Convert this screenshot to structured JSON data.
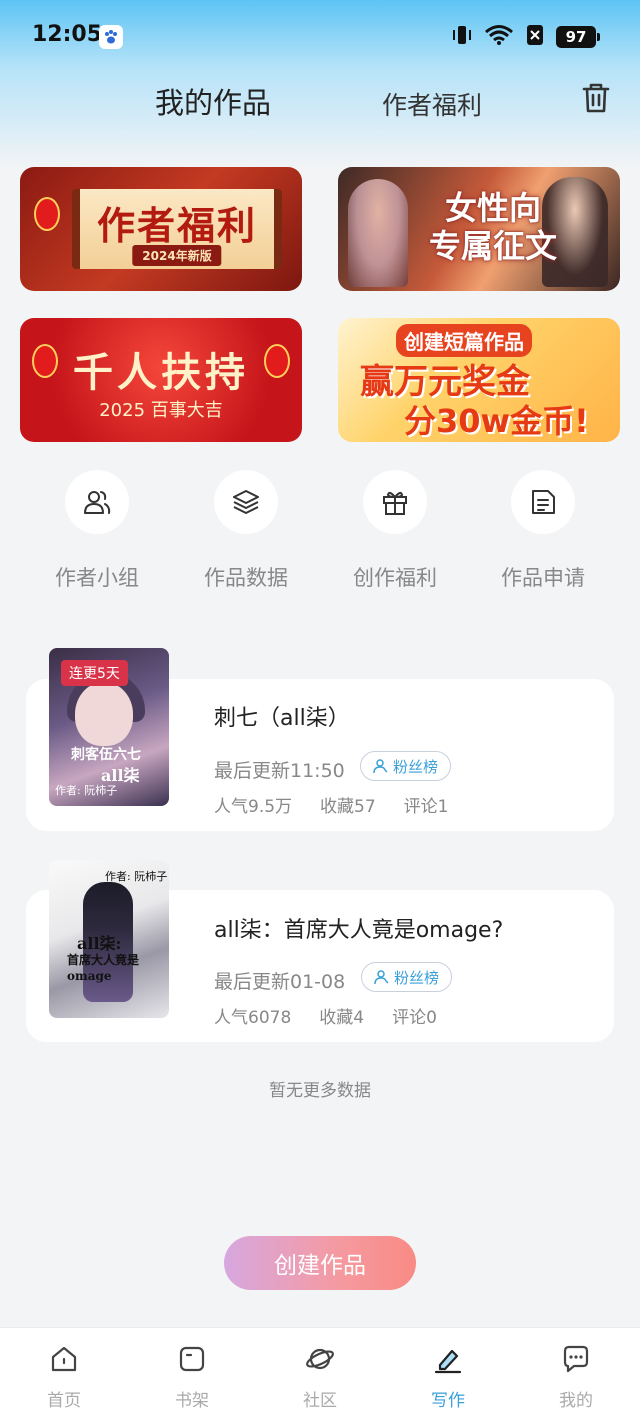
{
  "status_bar": {
    "time": "12:05",
    "battery": "97",
    "icons": [
      "baidu-app-icon",
      "vibrate-icon",
      "wifi-icon",
      "sim-icon",
      "battery-icon"
    ]
  },
  "header": {
    "tab_works": "我的作品",
    "tab_welfare": "作者福利",
    "trash_icon": "trash-icon"
  },
  "banners": {
    "b1": {
      "title": "作者福利",
      "subtitle": "2024年新版"
    },
    "b2": {
      "title_line1": "女性向",
      "title_line2": "专属征文"
    },
    "b3": {
      "title": "千人扶持",
      "subtitle": "2025 百事大吉"
    },
    "b4": {
      "line1": "创建短篇作品",
      "line2": "赢万元奖金",
      "line3": "分30w金币!"
    }
  },
  "quick_actions": [
    {
      "label": "作者小组",
      "icon": "group-icon"
    },
    {
      "label": "作品数据",
      "icon": "layers-icon"
    },
    {
      "label": "创作福利",
      "icon": "gift-icon"
    },
    {
      "label": "作品申请",
      "icon": "document-icon"
    }
  ],
  "works": [
    {
      "cover_badge": "连更5天",
      "cover_title": "刺客伍六七",
      "cover_sub": "all柒",
      "cover_author": "作者: 阮柿子",
      "title": "刺七（all柒）",
      "updated": "最后更新11:50",
      "fans_badge": "粉丝榜",
      "popularity": "人气9.5万",
      "favorites": "收藏57",
      "comments": "评论1"
    },
    {
      "cover_title": "all柒:",
      "cover_sub": "首席大人竟是omage",
      "cover_author": "作者: 阮柿子",
      "title": "all柒：首席大人竟是omage?",
      "updated": "最后更新01-08",
      "fans_badge": "粉丝榜",
      "popularity": "人气6078",
      "favorites": "收藏4",
      "comments": "评论0"
    }
  ],
  "no_more": "暂无更多数据",
  "create_button": "创建作品",
  "bottom_nav": [
    {
      "label": "首页",
      "icon": "home-icon",
      "active": false
    },
    {
      "label": "书架",
      "icon": "bookshelf-icon",
      "active": false
    },
    {
      "label": "社区",
      "icon": "planet-icon",
      "active": false
    },
    {
      "label": "写作",
      "icon": "pen-icon",
      "active": true
    },
    {
      "label": "我的",
      "icon": "chat-icon",
      "active": false
    }
  ],
  "colors": {
    "accent": "#3aa0d8",
    "create_gradient_start": "#d7a7e0",
    "create_gradient_end": "#f98a84",
    "badge_red": "#d9334a"
  }
}
